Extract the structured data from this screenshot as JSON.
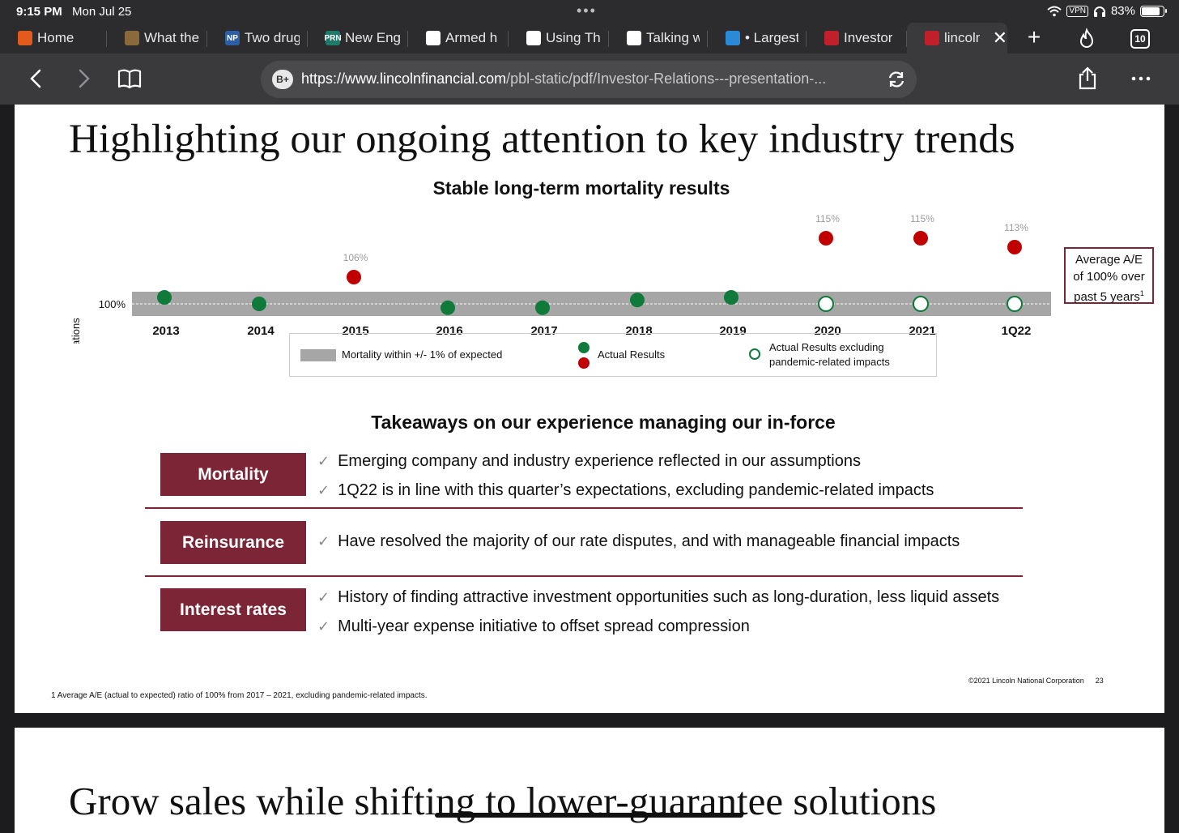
{
  "status": {
    "time": "9:15 PM",
    "date": "Mon Jul 25",
    "vpn": "VPN",
    "battery": "83%"
  },
  "tabs": [
    {
      "label": "Home",
      "fav_color": "#e25a1c",
      "fav_text": "",
      "left": 0,
      "width": 132
    },
    {
      "label": "What the",
      "fav_color": "#8a6a3a",
      "fav_text": "",
      "left": 132,
      "width": 124
    },
    {
      "label": "Two drug",
      "fav_color": "#2d5fa8",
      "fav_text": "NP",
      "left": 256,
      "width": 124
    },
    {
      "label": "New Eng",
      "fav_color": "#1e7a6a",
      "fav_text": "PRN",
      "left": 380,
      "width": 124
    },
    {
      "label": "Armed h",
      "fav_color": "#ffffff",
      "fav_text": "",
      "left": 504,
      "width": 124
    },
    {
      "label": "Using Th",
      "fav_color": "#ffffff",
      "fav_text": "",
      "left": 628,
      "width": 124
    },
    {
      "label": "Talking w",
      "fav_color": "#ffffff",
      "fav_text": "",
      "left": 752,
      "width": 122
    },
    {
      "label": "• Largest",
      "fav_color": "#2a8ad8",
      "fav_text": "",
      "left": 874,
      "width": 122
    },
    {
      "label": "Investor",
      "fav_color": "#c0202a",
      "fav_text": "",
      "left": 996,
      "width": 124
    },
    {
      "label": "lincoln",
      "fav_color": "#c0202a",
      "fav_text": "",
      "left": 1120,
      "width": 124
    }
  ],
  "tab_count": "10",
  "address": {
    "badge": "B+",
    "host": "https://www.lincolnfinancial.com",
    "path": "/pbl-static/pdf/Investor-Relations---presentation-..."
  },
  "slide": {
    "title": "Highlighting our ongoing attention to key industry trends",
    "ae_box": {
      "line1": "Average A/E",
      "line2": "of 100% over",
      "line3": "past 5 years",
      "sup": "1"
    },
    "legend": {
      "band": "Mortality within +/- 1% of expected",
      "actual": "Actual Results",
      "excluding_line1": "Actual Results excluding",
      "excluding_line2": "pandemic-related impacts"
    },
    "takeaways_title": "Takeaways on our experience managing our in-force",
    "rows": [
      {
        "label": "Mortality",
        "bullets": [
          "Emerging company and industry experience reflected in our assumptions",
          "1Q22 is in line with this quarter’s expectations, excluding pandemic-related impacts"
        ]
      },
      {
        "label": "Reinsurance",
        "bullets": [
          "Have resolved the majority of our rate disputes, and with manageable financial impacts"
        ]
      },
      {
        "label": "Interest rates",
        "bullets": [
          "History of finding attractive investment opportunities such as long-duration, less liquid assets",
          "Multi-year expense initiative to offset spread compression"
        ]
      }
    ],
    "check": "✓",
    "footnote": "1  Average A/E (actual to expected) ratio of 100% from 2017 – 2021, excluding pandemic-related impacts.",
    "copyright": "©2021 Lincoln National Corporation",
    "page_number": "23"
  },
  "next_slide_title": "Grow sales while shifting to lower-guarantee solutions",
  "colors": {
    "maroon": "#7b2536",
    "green": "#0f7a3a",
    "red": "#c00000",
    "band": "#a6a6a6"
  },
  "chart_data": {
    "type": "scatter",
    "title": "Stable long-term mortality results",
    "ylabel": "Actual/annual expectations",
    "y_reference_label": "100%",
    "categories": [
      "2013",
      "2014",
      "2015",
      "2016",
      "2017",
      "2018",
      "2019",
      "2020",
      "2021",
      "1Q22"
    ],
    "band": {
      "label": "Mortality within +/- 1% of expected",
      "low": 99,
      "high": 101
    },
    "series": [
      {
        "name": "Actual Results",
        "values": [
          100.5,
          100,
          106,
          99.7,
          99.7,
          100.3,
          100.5,
          115,
          115,
          113
        ],
        "colors": [
          "green",
          "green",
          "red",
          "green",
          "green",
          "green",
          "green",
          "red",
          "red",
          "red"
        ]
      },
      {
        "name": "Actual Results excluding pandemic-related impacts",
        "values": [
          null,
          null,
          null,
          null,
          null,
          null,
          null,
          100,
          100,
          100
        ]
      }
    ],
    "data_labels": {
      "2015": "106%",
      "2020": "115%",
      "2021": "115%",
      "1Q22": "113%"
    },
    "legend_position": "bottom"
  }
}
